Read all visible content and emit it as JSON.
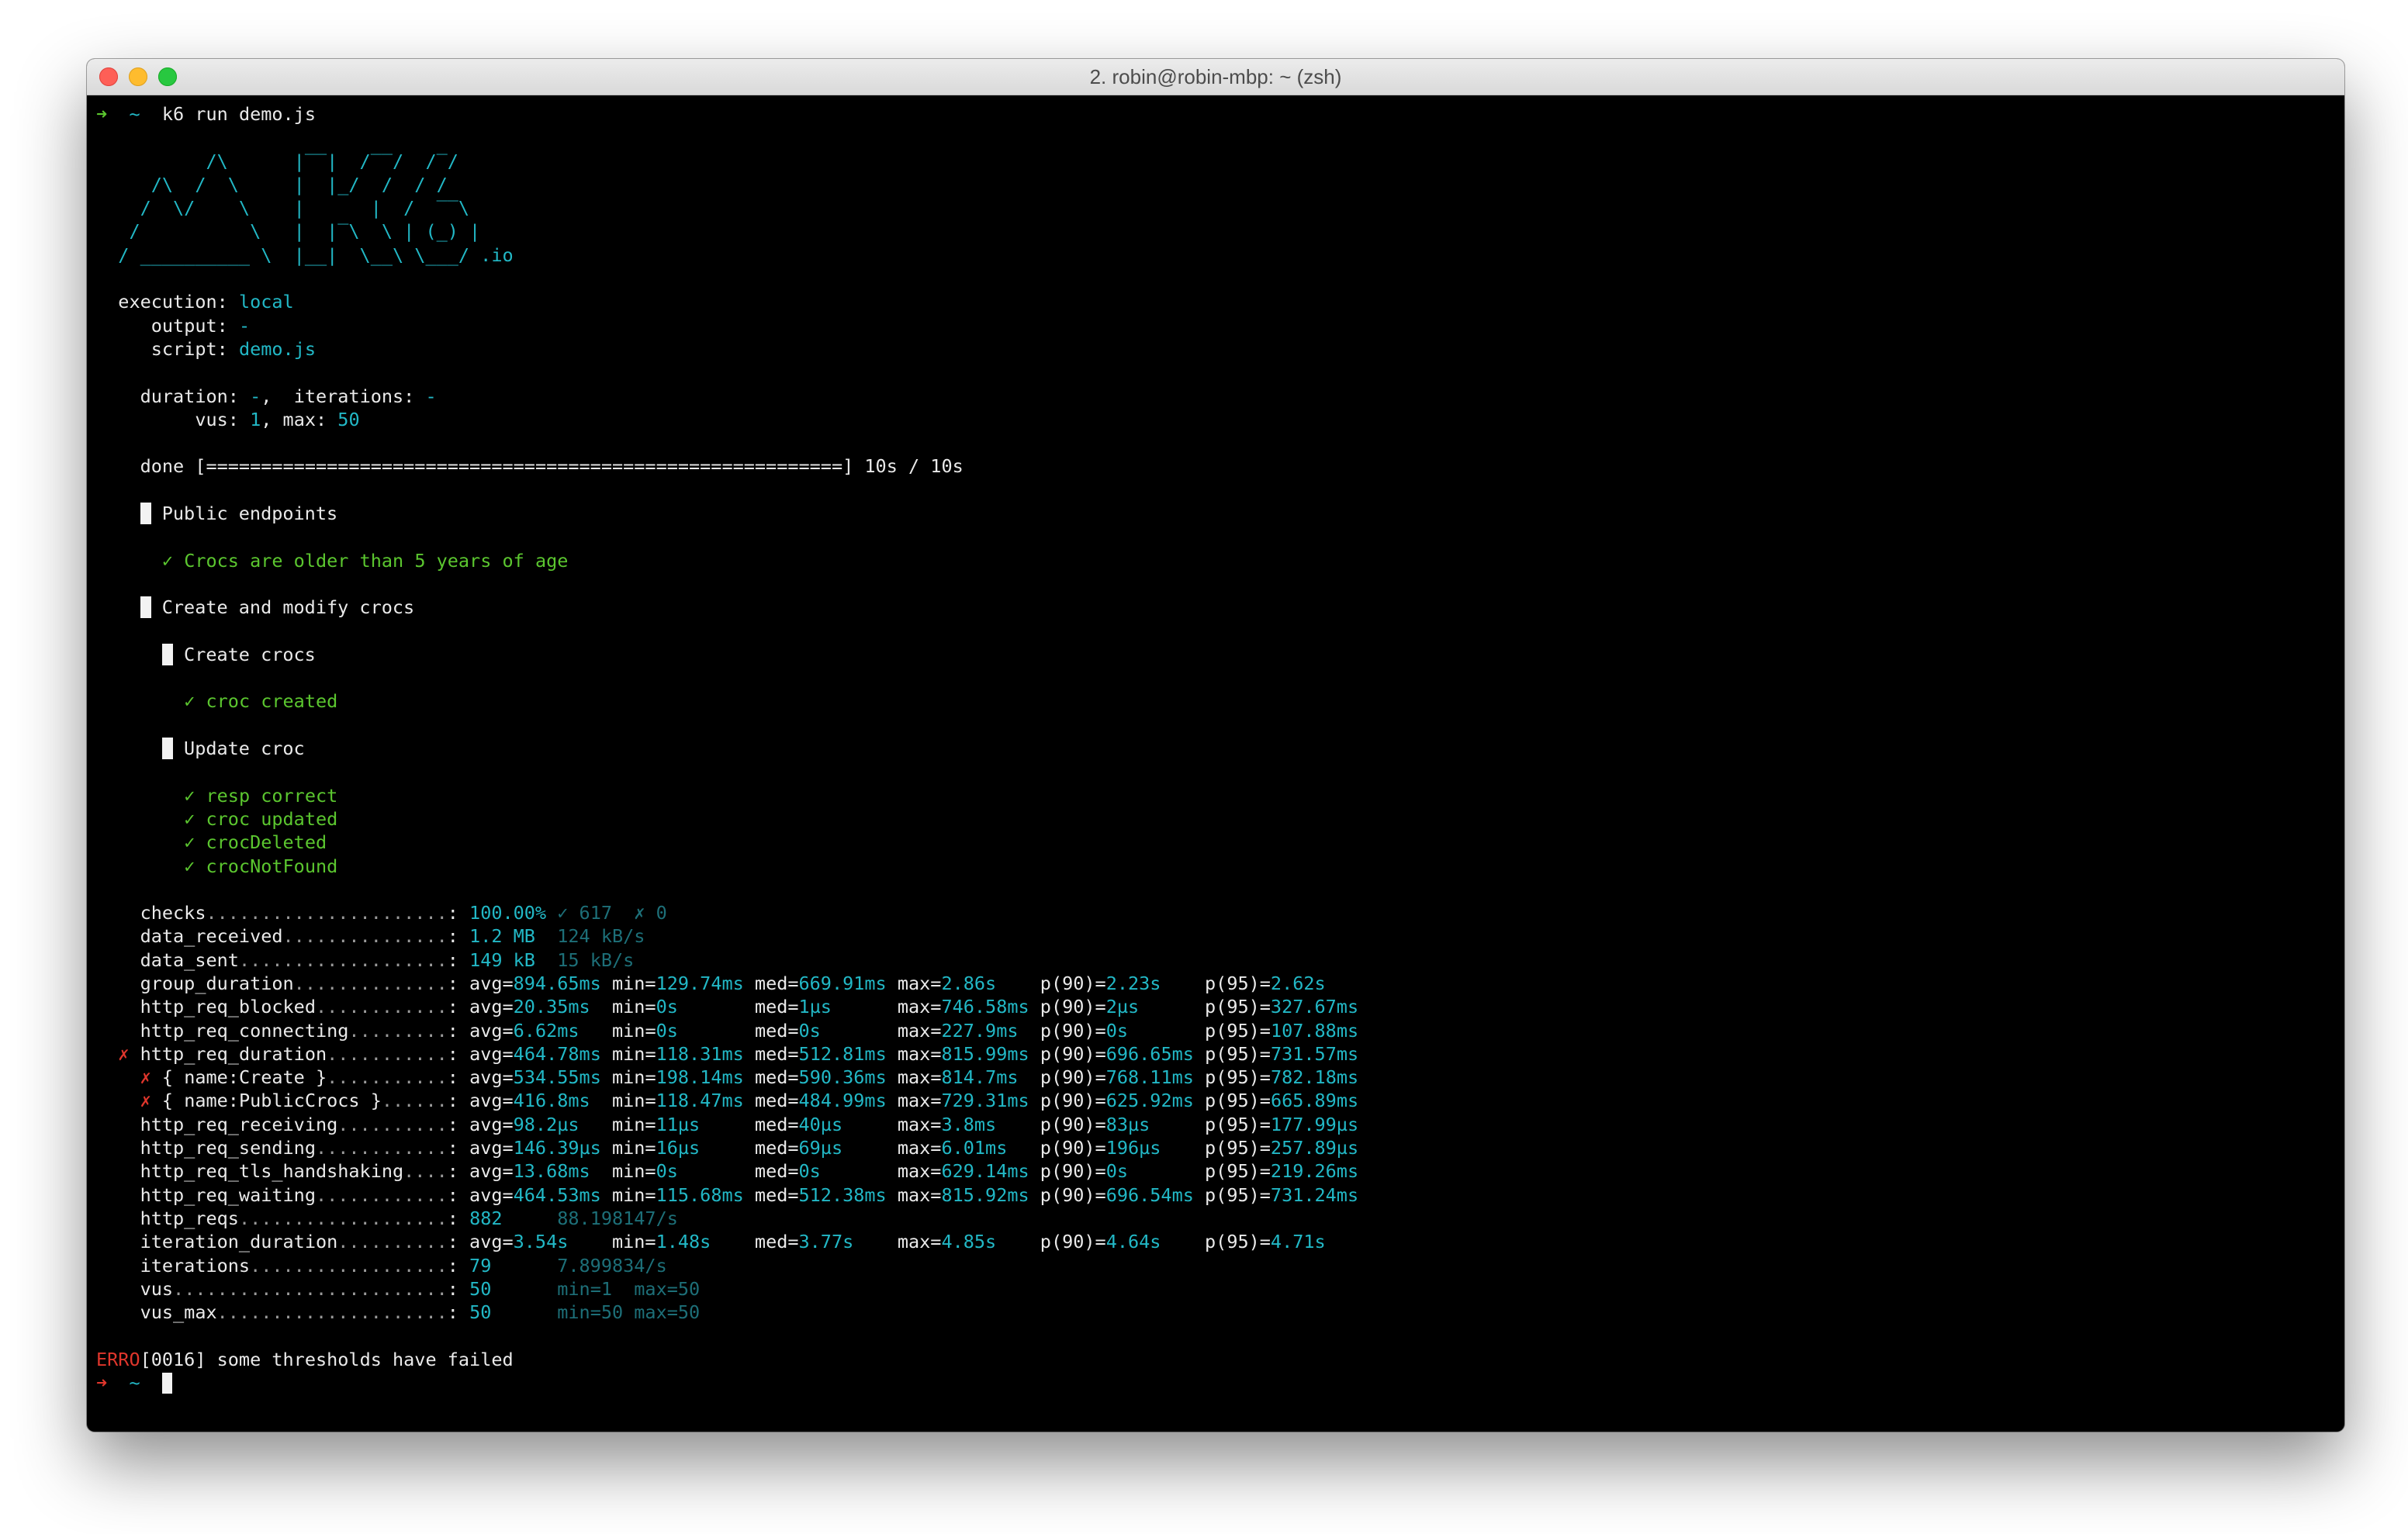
{
  "window": {
    "title": "2. robin@robin-mbp: ~ (zsh)"
  },
  "prompt": {
    "arrow": "➜",
    "dir": "~",
    "command": "k6 run demo.js"
  },
  "logo": [
    "          /\\      |‾‾|  /‾‾/  /‾/",
    "     /\\  /  \\     |  |_/  /  / /",
    "    /  \\/    \\    |      |  /  ‾‾\\",
    "   /          \\   |  |‾\\  \\ | (_) |",
    "  / __________ \\  |__|  \\__\\ \\___/ .io"
  ],
  "run": {
    "execution_label": "execution:",
    "execution": "local",
    "output_label": "output:",
    "output": "-",
    "script_label": "script:",
    "script": "demo.js",
    "duration_label": "duration:",
    "duration": "-",
    "iterations_label": "iterations:",
    "iterations": "-",
    "vus_label": "vus:",
    "vus": "1",
    "max_label": "max:",
    "max": "50"
  },
  "progress": {
    "label": "done",
    "bar": "[==========================================================]",
    "time": "10s / 10s",
    "fraction": 1.0
  },
  "groups": {
    "public": "Public endpoints",
    "public_check": "Crocs are older than 5 years of age",
    "create_modify": "Create and modify crocs",
    "create": "Create crocs",
    "create_check": "croc created",
    "update": "Update croc",
    "update_checks": [
      "resp correct",
      "croc updated",
      "crocDeleted",
      "crocNotFound"
    ]
  },
  "marks": {
    "pass": "✓",
    "fail": "✗"
  },
  "metrics": {
    "checks": {
      "name": "checks",
      "value": "100.00%",
      "pass": "617",
      "fail": "0"
    },
    "data_received": {
      "name": "data_received",
      "value": "1.2 MB",
      "rate": "124 kB/s"
    },
    "data_sent": {
      "name": "data_sent",
      "value": "149 kB",
      "rate": "15 kB/s"
    },
    "group_duration": {
      "name": "group_duration",
      "avg": "894.65ms",
      "min": "129.74ms",
      "med": "669.91ms",
      "max": "2.86s",
      "p90": "2.23s",
      "p95": "2.62s"
    },
    "http_req_blocked": {
      "name": "http_req_blocked",
      "avg": "20.35ms",
      "min": "0s",
      "med": "1µs",
      "max": "746.58ms",
      "p90": "2µs",
      "p95": "327.67ms"
    },
    "http_req_connecting": {
      "name": "http_req_connecting",
      "avg": "6.62ms",
      "min": "0s",
      "med": "0s",
      "max": "227.9ms",
      "p90": "0s",
      "p95": "107.88ms"
    },
    "http_req_duration": {
      "name": "http_req_duration",
      "avg": "464.78ms",
      "min": "118.31ms",
      "med": "512.81ms",
      "max": "815.99ms",
      "p90": "696.65ms",
      "p95": "731.57ms"
    },
    "name_create": {
      "name": "{ name:Create }",
      "avg": "534.55ms",
      "min": "198.14ms",
      "med": "590.36ms",
      "max": "814.7ms",
      "p90": "768.11ms",
      "p95": "782.18ms"
    },
    "name_publiccrocs": {
      "name": "{ name:PublicCrocs }",
      "avg": "416.8ms",
      "min": "118.47ms",
      "med": "484.99ms",
      "max": "729.31ms",
      "p90": "625.92ms",
      "p95": "665.89ms"
    },
    "http_req_receiving": {
      "name": "http_req_receiving",
      "avg": "98.2µs",
      "min": "11µs",
      "med": "40µs",
      "max": "3.8ms",
      "p90": "83µs",
      "p95": "177.99µs"
    },
    "http_req_sending": {
      "name": "http_req_sending",
      "avg": "146.39µs",
      "min": "16µs",
      "med": "69µs",
      "max": "6.01ms",
      "p90": "196µs",
      "p95": "257.89µs"
    },
    "http_req_tls_handshaking": {
      "name": "http_req_tls_handshaking",
      "avg": "13.68ms",
      "min": "0s",
      "med": "0s",
      "max": "629.14ms",
      "p90": "0s",
      "p95": "219.26ms"
    },
    "http_req_waiting": {
      "name": "http_req_waiting",
      "avg": "464.53ms",
      "min": "115.68ms",
      "med": "512.38ms",
      "max": "815.92ms",
      "p90": "696.54ms",
      "p95": "731.24ms"
    },
    "http_reqs": {
      "name": "http_reqs",
      "value": "882",
      "rate": "88.198147/s"
    },
    "iteration_duration": {
      "name": "iteration_duration",
      "avg": "3.54s",
      "min": "1.48s",
      "med": "3.77s",
      "max": "4.85s",
      "p90": "4.64s",
      "p95": "4.71s"
    },
    "iterations": {
      "name": "iterations",
      "value": "79",
      "rate": "7.899834/s"
    },
    "vus": {
      "name": "vus",
      "value": "50",
      "extra": "min=1  max=50"
    },
    "vus_max": {
      "name": "vus_max",
      "value": "50",
      "extra": "min=50 max=50"
    }
  },
  "error": {
    "level": "ERRO",
    "code": "[0016]",
    "message": "some thresholds have failed"
  },
  "colors": {
    "cyan": "#22b8c6",
    "green": "#5bc62f",
    "red": "#e0362c",
    "dim_cyan": "#1d6f78"
  }
}
